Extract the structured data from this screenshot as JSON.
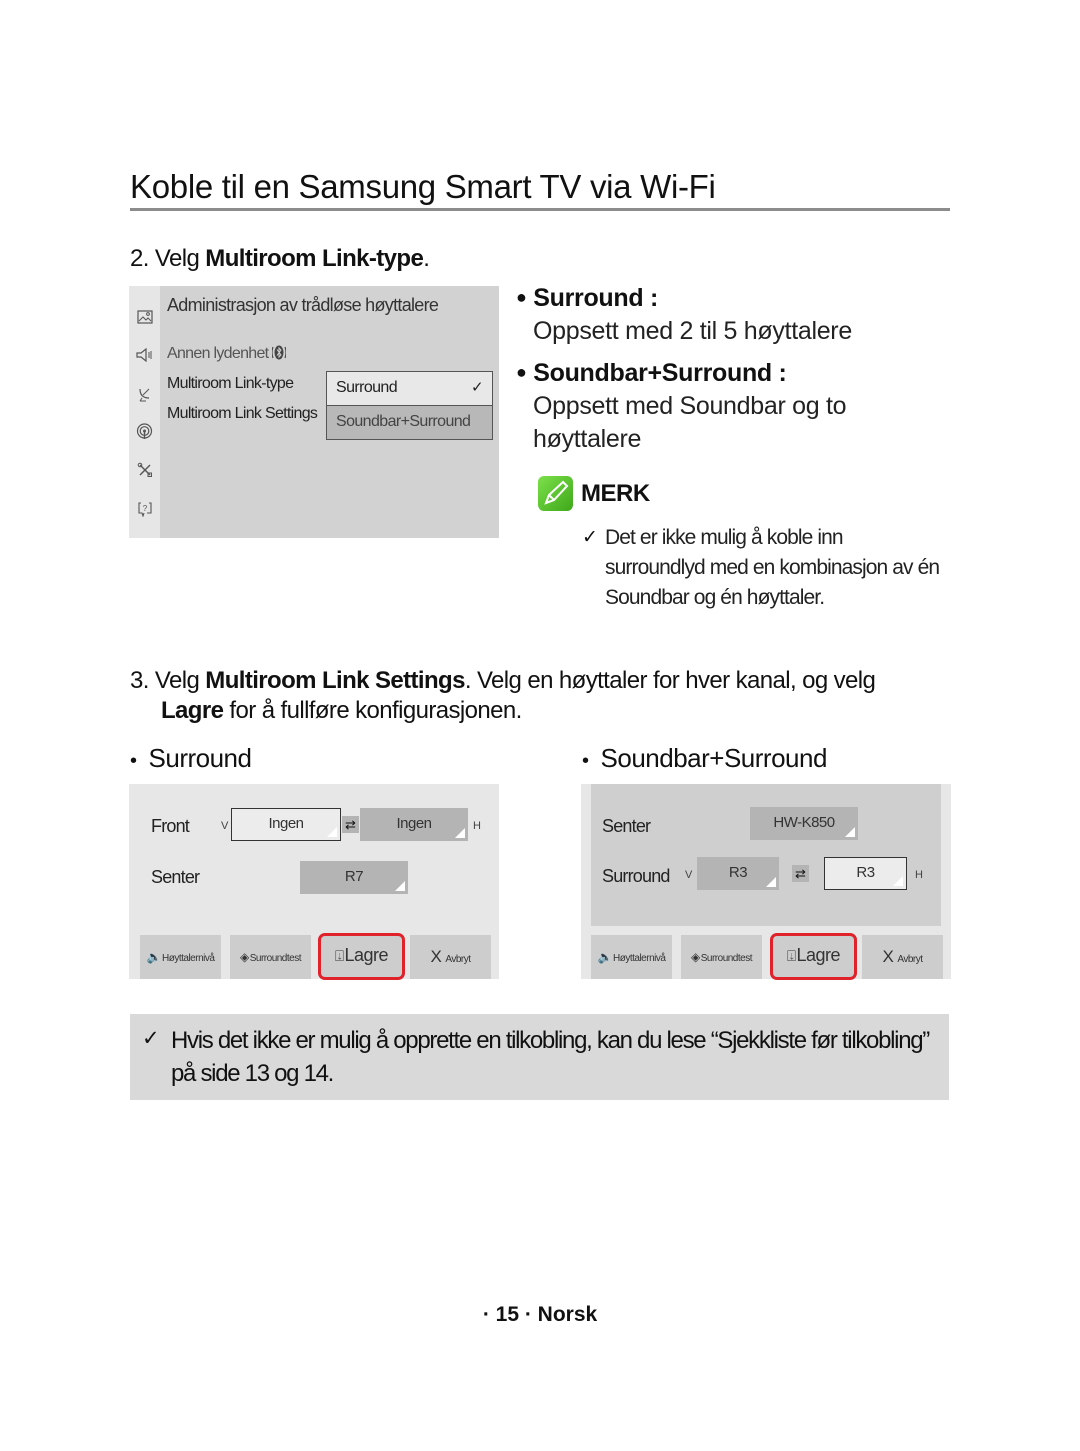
{
  "page": {
    "title": "Koble til en Samsung Smart TV via Wi-Fi",
    "footer": "· 15 · Norsk"
  },
  "step2": {
    "number": "2.",
    "prefix": "Velg",
    "bold": "Multiroom Link-type",
    "suffix": "."
  },
  "tv_menu": {
    "rail_icons": [
      "picture-icon",
      "sound-icon",
      "broadcast-icon",
      "network-icon",
      "tools-icon",
      "support-icon"
    ],
    "header": "Administrasjon av trådløse høyttalere",
    "items": [
      {
        "label": "Annen lydenhet",
        "suffix_icon": "bluetooth-icon"
      },
      {
        "label": "Multiroom Link-type"
      },
      {
        "label": "Multiroom Link Settings"
      }
    ],
    "dropdown": {
      "options": [
        {
          "label": "Surround",
          "selected": true,
          "check": "✓"
        },
        {
          "label": "Soundbar+Surround",
          "selected": false
        }
      ]
    }
  },
  "bullets": [
    {
      "head": "Surround :",
      "body": "Oppsett med 2 til 5 høyttalere"
    },
    {
      "head": "Soundbar+Surround :",
      "body_line1": "Oppsett med Soundbar og to",
      "body_line2": "høyttalere"
    }
  ],
  "merk": {
    "label": "MERK",
    "check": "✓",
    "text": "Det er ikke mulig å koble inn surroundlyd med en kombinasjon av én Soundbar og én høyttaler."
  },
  "step3": {
    "number": "3.",
    "prefix": "Velg",
    "bold1": "Multiroom Link Settings",
    "middle": ". Velg en høyttaler for hver kanal, og velg",
    "bold2": "Lagre",
    "suffix": " for å fullføre konfigurasjonen."
  },
  "subsections": {
    "left": "Surround",
    "right": "Soundbar+Surround",
    "bullet": "•"
  },
  "panel_surround": {
    "rows": [
      {
        "label": "Front",
        "left_tag": "V",
        "left_value": "Ingen",
        "right_value": "Ingen",
        "right_tag": "H",
        "swap": "⇄"
      },
      {
        "label": "Senter",
        "value": "R7"
      }
    ],
    "buttons": {
      "level": "Høyttalernivå",
      "test": "Surroundtest",
      "save": "Lagre",
      "cancel": "Avbryt"
    }
  },
  "panel_soundbar": {
    "rows": [
      {
        "label": "Senter",
        "value": "HW-K850"
      },
      {
        "label": "Surround",
        "left_tag": "V",
        "left_value": "R3",
        "right_value": "R3",
        "right_tag": "H",
        "swap": "⇄"
      }
    ],
    "buttons": {
      "level": "Høyttalernivå",
      "test": "Surroundtest",
      "save": "Lagre",
      "cancel": "Avbryt"
    }
  },
  "bottom_note": {
    "check": "✓",
    "text": "Hvis det ikke er mulig å opprette en tilkobling, kan du lese “Sjekkliste før tilkobling” på side 13 og 14."
  },
  "colors": {
    "save_highlight": "#e0222b",
    "merk_green": "#4cbf24",
    "rule": "#8c8c8c"
  }
}
